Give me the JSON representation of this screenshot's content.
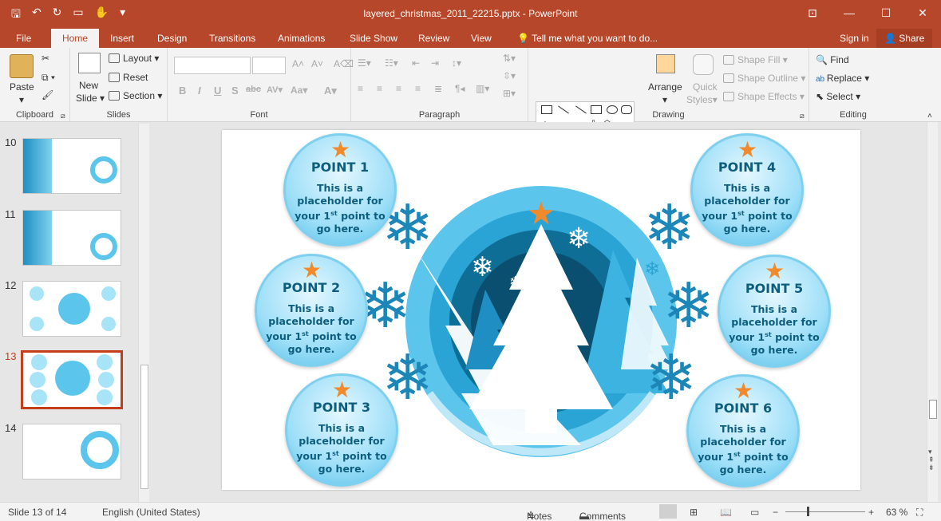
{
  "window": {
    "title": "layered_christmas_2011_22215.pptx - PowerPoint"
  },
  "tabs": [
    "File",
    "Home",
    "Insert",
    "Design",
    "Transitions",
    "Animations",
    "Slide Show",
    "Review",
    "View"
  ],
  "tell_me": "Tell me what you want to do...",
  "account": {
    "sign_in": "Sign in",
    "share": "Share"
  },
  "ribbon": {
    "clipboard": {
      "label": "Clipboard",
      "paste": "Paste"
    },
    "slides": {
      "label": "Slides",
      "new_slide_1": "New",
      "new_slide_2": "Slide",
      "layout": "Layout",
      "reset": "Reset",
      "section": "Section"
    },
    "font": {
      "label": "Font"
    },
    "paragraph": {
      "label": "Paragraph"
    },
    "drawing": {
      "label": "Drawing",
      "arrange": "Arrange",
      "quick_styles_1": "Quick",
      "quick_styles_2": "Styles",
      "shape_fill": "Shape Fill",
      "shape_outline": "Shape Outline",
      "shape_effects": "Shape Effects"
    },
    "editing": {
      "label": "Editing",
      "find": "Find",
      "replace": "Replace",
      "select": "Select"
    }
  },
  "thumbnails": [
    {
      "num": "10"
    },
    {
      "num": "11"
    },
    {
      "num": "12"
    },
    {
      "num": "13"
    },
    {
      "num": "14"
    }
  ],
  "slide": {
    "points": [
      {
        "head": "POINT 1",
        "l1": "This is a",
        "l2": "placeholder for",
        "l3a": "your 1",
        "sup": "st",
        "l3b": " point to",
        "l4": "go here."
      },
      {
        "head": "POINT 2",
        "l1": "This is a",
        "l2": "placeholder for",
        "l3a": "your 1",
        "sup": "st",
        "l3b": " point to",
        "l4": "go here."
      },
      {
        "head": "POINT 3",
        "l1": "This is a",
        "l2": "placeholder for",
        "l3a": "your 1",
        "sup": "st",
        "l3b": " point to",
        "l4": "go here."
      },
      {
        "head": "POINT 4",
        "l1": "This is a",
        "l2": "placeholder for",
        "l3a": "your 1",
        "sup": "st",
        "l3b": " point to",
        "l4": "go here."
      },
      {
        "head": "POINT 5",
        "l1": "This is a",
        "l2": "placeholder for",
        "l3a": "your 1",
        "sup": "st",
        "l3b": " point to",
        "l4": "go here."
      },
      {
        "head": "POINT 6",
        "l1": "This is a",
        "l2": "placeholder for",
        "l3a": "your 1",
        "sup": "st",
        "l3b": " point to",
        "l4": "go here."
      }
    ],
    "colors": {
      "accent": "#1b86b7",
      "star": "#f28a2c",
      "ring": "#5cc5ec"
    }
  },
  "status": {
    "slide": "Slide 13 of 14",
    "language": "English (United States)",
    "notes": "Notes",
    "comments": "Comments",
    "zoom": "63 %"
  }
}
